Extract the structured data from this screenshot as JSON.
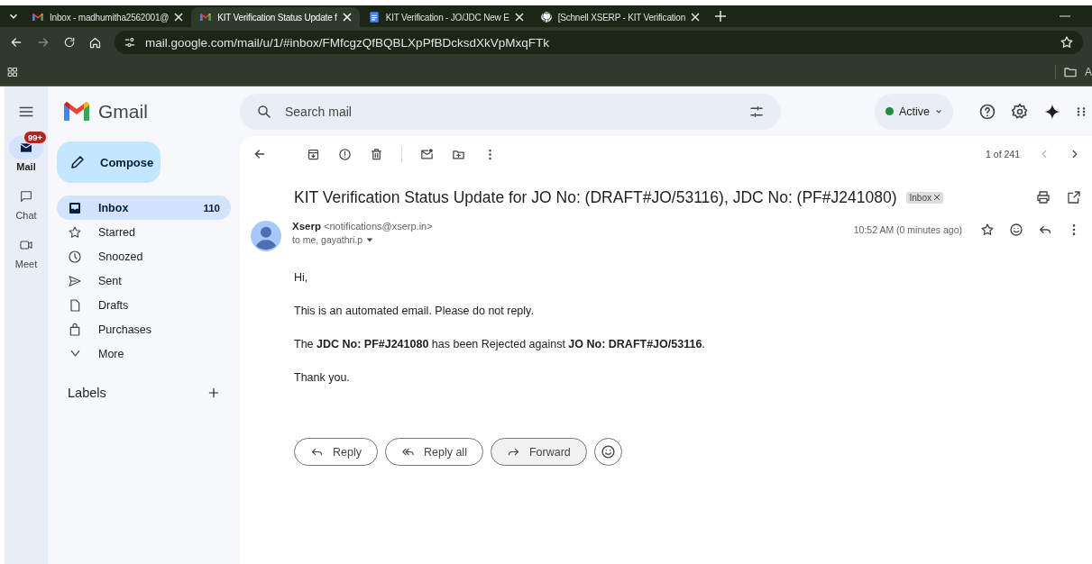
{
  "browser": {
    "tabs": [
      {
        "title": "Inbox - madhumitha2562001@",
        "selected": false,
        "kind": "gmail"
      },
      {
        "title": "KIT Verification Status Update f",
        "selected": true,
        "kind": "gmail"
      },
      {
        "title": "KIT Verification - JO/JDC New E",
        "selected": false,
        "kind": "docs"
      },
      {
        "title": "[Schnell XSERP - KIT Verification",
        "selected": false,
        "kind": "github"
      }
    ],
    "url": "mail.google.com/mail/u/1/#inbox/FMfcgzQfBQBLXpPfBDcksdXkVpMxqFTk",
    "bookmark": "A"
  },
  "header": {
    "app_name": "Gmail",
    "search": {
      "placeholder": "Search mail"
    },
    "status": "Active"
  },
  "rail": [
    {
      "label": "Mail",
      "selected": true,
      "kind": "mail",
      "badge": "99+"
    },
    {
      "label": "Chat",
      "selected": false,
      "kind": "chat"
    },
    {
      "label": "Meet",
      "selected": false,
      "kind": "meet"
    }
  ],
  "compose": "Compose",
  "folders": [
    {
      "label": "Inbox",
      "count": "110",
      "selected": true,
      "kind": "inbox"
    },
    {
      "label": "Starred",
      "selected": false,
      "kind": "star"
    },
    {
      "label": "Snoozed",
      "selected": false,
      "kind": "clock"
    },
    {
      "label": "Sent",
      "selected": false,
      "kind": "send"
    },
    {
      "label": "Drafts",
      "selected": false,
      "kind": "draft"
    },
    {
      "label": "Purchases",
      "selected": false,
      "kind": "bag"
    },
    {
      "label": "More",
      "selected": false,
      "kind": "chevron"
    }
  ],
  "labels": {
    "title": "Labels"
  },
  "mail": {
    "position": "1 of 241",
    "subject": "KIT Verification Status Update for JO No: (DRAFT#JO/53116), JDC No: (PF#J241080)",
    "tag": "Inbox",
    "sender": {
      "name": "Xserp",
      "email": "<notifications@xserp.in>",
      "recipients": "to me, gayathri.p"
    },
    "time": "10:52 AM (0 minutes ago)",
    "body": [
      "Hi,",
      "This is an automated email. Please do not reply.",
      "The **JDC No: PF#J241080** has been Rejected against **JO No: DRAFT#JO/53116**.",
      "Thank you."
    ],
    "actions": [
      {
        "label": "Reply",
        "kind": "reply",
        "hovered": false
      },
      {
        "label": "Reply all",
        "kind": "replyall",
        "hovered": false
      },
      {
        "label": "Forward",
        "kind": "forward",
        "hovered": true
      }
    ]
  }
}
